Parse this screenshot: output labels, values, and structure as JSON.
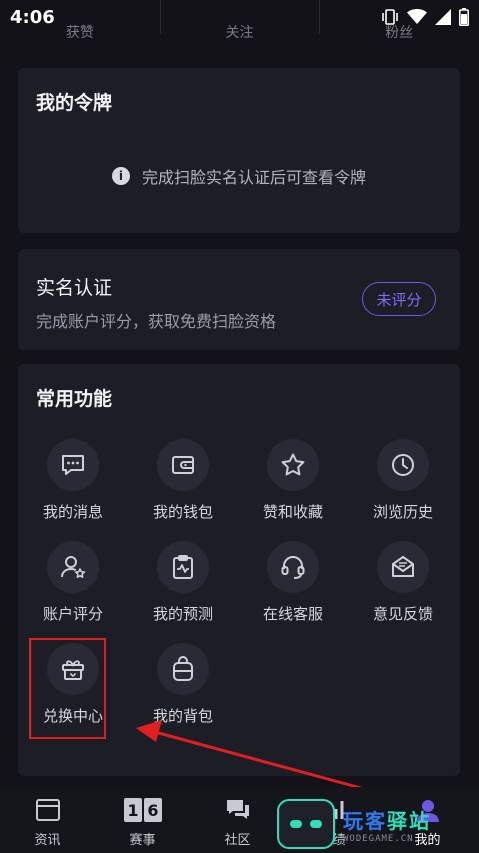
{
  "status": {
    "time": "4:06"
  },
  "stats": [
    "获赞",
    "关注",
    "粉丝"
  ],
  "token_card": {
    "title": "我的令牌",
    "hint": "完成扫脸实名认证后可查看令牌"
  },
  "realname": {
    "title": "实名认证",
    "desc": "完成账户评分，获取免费扫脸资格",
    "button": "未评分"
  },
  "functions": {
    "title": "常用功能",
    "items": [
      {
        "label": "我的消息",
        "icon": "message-icon"
      },
      {
        "label": "我的钱包",
        "icon": "wallet-icon"
      },
      {
        "label": "赞和收藏",
        "icon": "star-icon"
      },
      {
        "label": "浏览历史",
        "icon": "clock-icon"
      },
      {
        "label": "账户评分",
        "icon": "user-star-icon"
      },
      {
        "label": "我的预测",
        "icon": "clipboard-chart-icon"
      },
      {
        "label": "在线客服",
        "icon": "headset-icon"
      },
      {
        "label": "意见反馈",
        "icon": "mail-edit-icon"
      },
      {
        "label": "兑换中心",
        "icon": "gift-icon"
      },
      {
        "label": "我的背包",
        "icon": "backpack-icon"
      }
    ]
  },
  "tabs": [
    {
      "label": "资讯",
      "icon": "news-icon"
    },
    {
      "label": "赛事",
      "icon": "scoreboard-icon"
    },
    {
      "label": "社区",
      "icon": "chat-icon"
    },
    {
      "label": "战绩",
      "icon": "stats-icon"
    },
    {
      "label": "我的",
      "icon": "profile-icon"
    }
  ],
  "watermark": {
    "name_a": "玩客",
    "name_b": "驿站",
    "url": "WODEGAME.CN"
  },
  "colors": {
    "accent": "#6d57e6",
    "highlight": "#e02020",
    "background": "#121218",
    "card": "#1d1d26"
  }
}
